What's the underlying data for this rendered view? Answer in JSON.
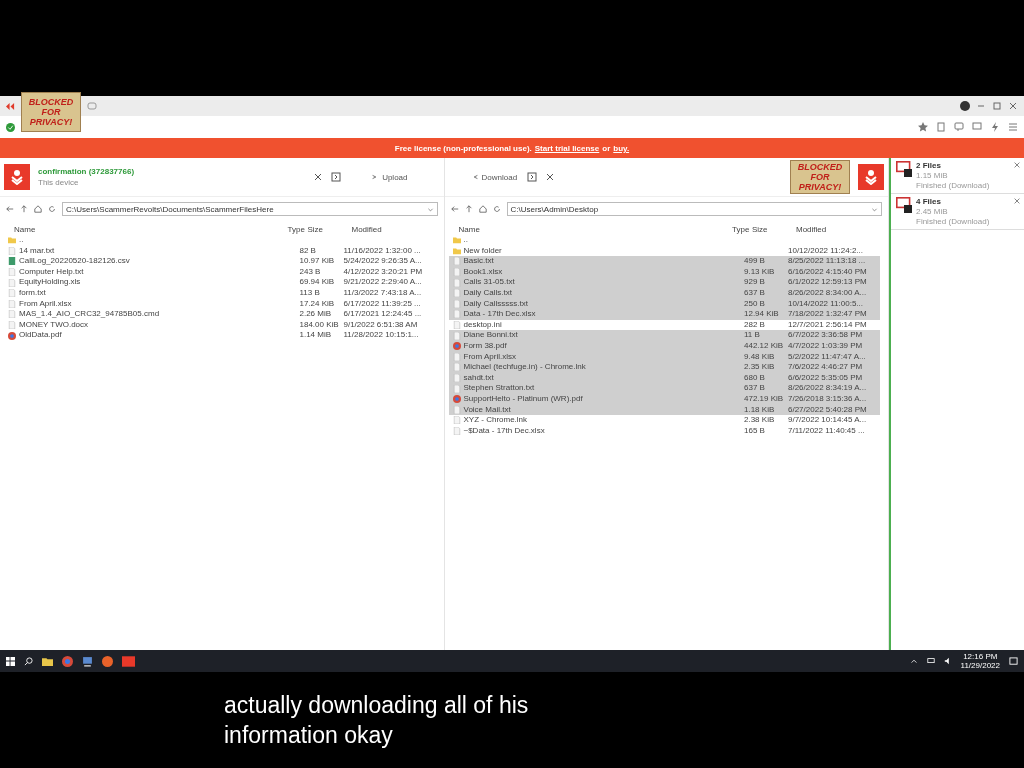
{
  "privacy_stickers": [
    "BLOCKED FOR PRIVACY!",
    "BLOCKED FOR PRIVACY!"
  ],
  "banner": {
    "text": "Free license (non-professional use).",
    "trial_link": "Start trial license",
    "or": "or",
    "buy_link": "buy."
  },
  "session": {
    "title": "confirmation (372837766)",
    "subtitle": "This device",
    "upload": "Upload",
    "download": "Download"
  },
  "local_panel": {
    "path": "C:\\Users\\ScammerRevolts\\Documents\\ScammerFilesHere",
    "columns": [
      "Name",
      "Type",
      "Size",
      "Modified"
    ],
    "rows": [
      {
        "kind": "folder",
        "name": "..",
        "size": "",
        "modified": "",
        "selected": false
      },
      {
        "kind": "file",
        "name": "14 mar.txt",
        "size": "82 B",
        "modified": "11/16/2022 1:32:00 ...",
        "selected": false
      },
      {
        "kind": "sheet",
        "name": "CallLog_20220520-182126.csv",
        "size": "10.97 KiB",
        "modified": "5/24/2022 9:26:35 A...",
        "selected": false
      },
      {
        "kind": "file",
        "name": "Computer Help.txt",
        "size": "243 B",
        "modified": "4/12/2022 3:20:21 PM",
        "selected": false
      },
      {
        "kind": "file",
        "name": "EquityHolding.xls",
        "size": "69.94 KiB",
        "modified": "9/21/2022 2:29:40 A...",
        "selected": false
      },
      {
        "kind": "file",
        "name": "form.txt",
        "size": "113 B",
        "modified": "11/3/2022 7:43:18 A...",
        "selected": false
      },
      {
        "kind": "file",
        "name": "From April.xlsx",
        "size": "17.24 KiB",
        "modified": "6/17/2022 11:39:25 ...",
        "selected": false
      },
      {
        "kind": "file",
        "name": "MAS_1.4_AIO_CRC32_94785B05.cmd",
        "size": "2.26 MiB",
        "modified": "6/17/2021 12:24:45 ...",
        "selected": false
      },
      {
        "kind": "file",
        "name": "MONEY TWO.docx",
        "size": "184.00 KiB",
        "modified": "9/1/2022 6:51:38 AM",
        "selected": false
      },
      {
        "kind": "pdf",
        "name": "OldData.pdf",
        "size": "1.14 MiB",
        "modified": "11/28/2022 10:15:1...",
        "selected": false
      }
    ]
  },
  "remote_panel": {
    "path": "C:\\Users\\Admin\\Desktop",
    "columns": [
      "Name",
      "Type",
      "Size",
      "Modified"
    ],
    "rows": [
      {
        "kind": "folder",
        "name": "..",
        "size": "",
        "modified": "",
        "selected": false
      },
      {
        "kind": "folder",
        "name": "New folder",
        "size": "",
        "modified": "10/12/2022 11:24:2...",
        "selected": false
      },
      {
        "kind": "file",
        "name": "Basic.txt",
        "size": "499 B",
        "modified": "8/25/2022 11:13:18 ...",
        "selected": true
      },
      {
        "kind": "file",
        "name": "Book1.xlsx",
        "size": "9.13 KiB",
        "modified": "6/16/2022 4:15:40 PM",
        "selected": true
      },
      {
        "kind": "file",
        "name": "Calls 31-05.txt",
        "size": "929 B",
        "modified": "6/1/2022 12:59:13 PM",
        "selected": true
      },
      {
        "kind": "file",
        "name": "Daily Calls.txt",
        "size": "637 B",
        "modified": "8/26/2022 8:34:00 A...",
        "selected": true
      },
      {
        "kind": "file",
        "name": "Daily Callsssss.txt",
        "size": "250 B",
        "modified": "10/14/2022 11:00:5...",
        "selected": true
      },
      {
        "kind": "file",
        "name": "Data - 17th Dec.xlsx",
        "size": "12.94 KiB",
        "modified": "7/18/2022 1:32:47 PM",
        "selected": true
      },
      {
        "kind": "file",
        "name": "desktop.ini",
        "size": "282 B",
        "modified": "12/7/2021 2:56:14 PM",
        "selected": false
      },
      {
        "kind": "file",
        "name": "Diane Bonni.txt",
        "size": "11 B",
        "modified": "6/7/2022 3:36:58 PM",
        "selected": true
      },
      {
        "kind": "pdf",
        "name": "Form 38.pdf",
        "size": "442.12 KiB",
        "modified": "4/7/2022 1:03:39 PM",
        "selected": true
      },
      {
        "kind": "file",
        "name": "From April.xlsx",
        "size": "9.48 KiB",
        "modified": "5/2/2022 11:47:47 A...",
        "selected": true
      },
      {
        "kind": "file",
        "name": "Michael (techfuge.in) - Chrome.lnk",
        "size": "2.35 KiB",
        "modified": "7/6/2022 4:46:27 PM",
        "selected": true
      },
      {
        "kind": "file",
        "name": "sahdt.txt",
        "size": "680 B",
        "modified": "6/6/2022 5:35:05 PM",
        "selected": true
      },
      {
        "kind": "file",
        "name": "Stephen Stratton.txt",
        "size": "637 B",
        "modified": "8/26/2022 8:34:19 A...",
        "selected": true
      },
      {
        "kind": "pdf",
        "name": "SupportHelto - Platinum (WR).pdf",
        "size": "472.19 KiB",
        "modified": "7/26/2018 3:15:36 A...",
        "selected": true
      },
      {
        "kind": "file",
        "name": "Voice Mail.txt",
        "size": "1.18 KiB",
        "modified": "6/27/2022 5:40:28 PM",
        "selected": true
      },
      {
        "kind": "file",
        "name": "XYZ - Chrome.lnk",
        "size": "2.38 KiB",
        "modified": "9/7/2022 10:14:45 A...",
        "selected": false
      },
      {
        "kind": "file",
        "name": "~$Data - 17th Dec.xlsx",
        "size": "165 B",
        "modified": "7/11/2022 11:40:45 ...",
        "selected": false
      }
    ]
  },
  "transfers": [
    {
      "title": "2 Files",
      "size": "1.15 MiB",
      "status": "Finished (Download)"
    },
    {
      "title": "4 Files",
      "size": "2.45 MiB",
      "status": "Finished (Download)"
    }
  ],
  "taskbar": {
    "time": "12:16 PM",
    "date": "11/29/2022"
  },
  "caption": [
    "actually downloading all of his",
    "information okay"
  ]
}
